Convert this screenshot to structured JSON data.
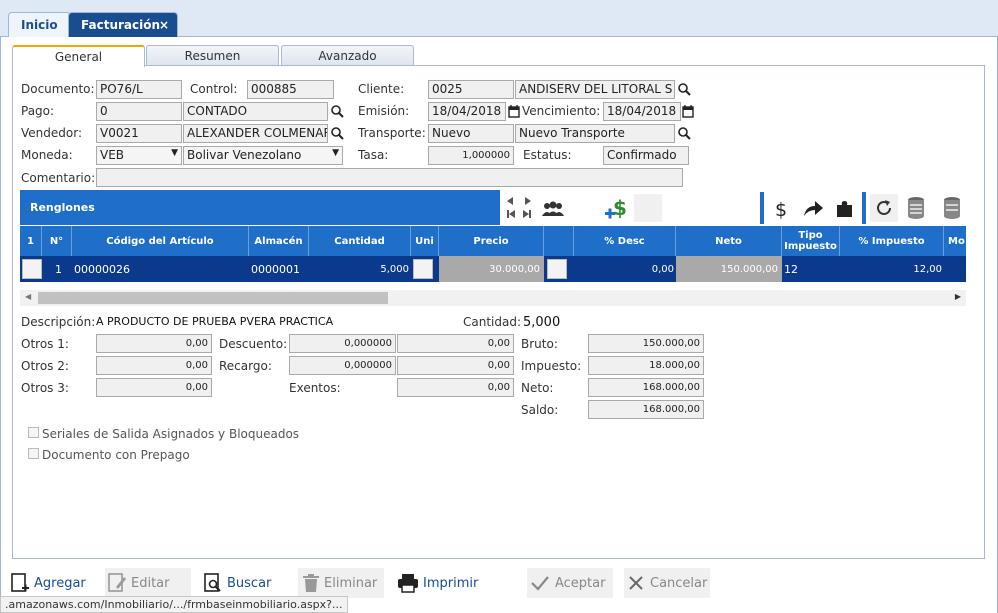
{
  "tabs": {
    "inicio": "Inicio",
    "facturacion": "Facturación",
    "close": "×"
  },
  "subtabs": {
    "general": "General",
    "resumen": "Resumen",
    "avanzado": "Avanzado"
  },
  "form": {
    "documento_label": "Documento:",
    "documento": "PO76/L",
    "control_label": "Control:",
    "control": "000885",
    "cliente_label": "Cliente:",
    "cliente_code": "0025",
    "cliente_name": "ANDISERV DEL LITORAL S",
    "pago_label": "Pago:",
    "pago_code": "0",
    "pago_name": "CONTADO",
    "emision_label": "Emisión:",
    "emision": "18/04/2018",
    "vencimiento_label": "Vencimiento:",
    "vencimiento": "18/04/2018",
    "vendedor_label": "Vendedor:",
    "vendedor_code": "V0021",
    "vendedor_name": "ALEXANDER COLMENAR",
    "transporte_label": "Transporte:",
    "transporte_code": "Nuevo",
    "transporte_name": "Nuevo Transporte",
    "moneda_label": "Moneda:",
    "moneda_code": "VEB",
    "moneda_name": "Bolivar Venezolano",
    "tasa_label": "Tasa:",
    "tasa": "1,000000",
    "estatus_label": "Estatus:",
    "estatus": "Confirmado",
    "comentario_label": "Comentario:",
    "comentario": ""
  },
  "renglones": {
    "title": "Renglones"
  },
  "grid": {
    "headers": [
      "1",
      "N°",
      "Código del Artículo",
      "Almacén",
      "Cantidad",
      "Uni",
      "Precio",
      "",
      "% Desc",
      "Neto",
      "Tipo Impuesto",
      "% Impuesto",
      "Mo"
    ],
    "row": {
      "num": "1",
      "codigo": "00000026",
      "almacen": "0000001",
      "cantidad": "5,000",
      "precio": "30.000,00",
      "desc": "0,00",
      "neto": "150.000,00",
      "tipo_impuesto": "12",
      "impuesto": "12,00"
    }
  },
  "summary": {
    "descripcion_label": "Descripción:",
    "descripcion": "A PRODUCTO DE PRUEBA PVERA PRACTICA",
    "cantidad_label": "Cantidad:",
    "cantidad": "5,000",
    "otros1_label": "Otros 1:",
    "otros1": "0,00",
    "otros2_label": "Otros 2:",
    "otros2": "0,00",
    "otros3_label": "Otros 3:",
    "otros3": "0,00",
    "descuento_label": "Descuento:",
    "descuento_pct": "0,000000",
    "descuento": "0,00",
    "recargo_label": "Recargo:",
    "recargo_pct": "0,000000",
    "recargo": "0,00",
    "exentos_label": "Exentos:",
    "exentos": "0,00",
    "bruto_label": "Bruto:",
    "bruto": "150.000,00",
    "impuesto_label": "Impuesto:",
    "impuesto": "18.000,00",
    "neto_label": "Neto:",
    "neto": "168.000,00",
    "saldo_label": "Saldo:",
    "saldo": "168.000,00",
    "seriales": "Seriales de Salida Asignados y Bloqueados",
    "prepago": "Documento con Prepago"
  },
  "footer": {
    "agregar": "Agregar",
    "editar": "Editar",
    "buscar": "Buscar",
    "eliminar": "Eliminar",
    "imprimir": "Imprimir",
    "aceptar": "Aceptar",
    "cancelar": "Cancelar"
  },
  "status_url": ".amazonaws.com/Inmobiliario/.../frmbaseinmobiliario.aspx?..."
}
